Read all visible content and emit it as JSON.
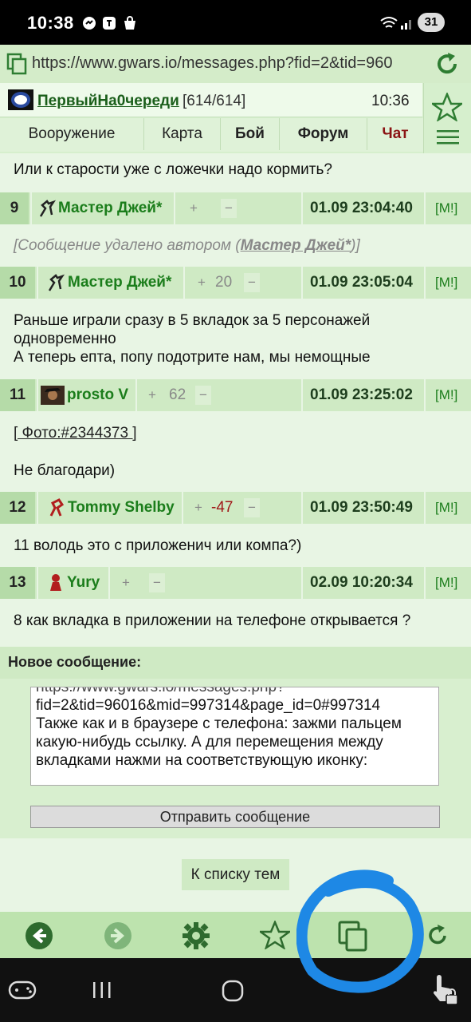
{
  "status": {
    "time": "10:38",
    "battery": "31",
    "signal_label": "5"
  },
  "browser": {
    "url": "https://www.gwars.io/messages.php?fid=2&tid=960"
  },
  "header": {
    "username": "ПервыйНа0череди",
    "hp": "[614/614]",
    "time": "10:36"
  },
  "nav": [
    "Вооружение",
    "Карта",
    "Бой",
    "Форум",
    "Чат"
  ],
  "top_text": "Или к старости уже с ложечки надо кормить?",
  "posts": [
    {
      "num": "9",
      "author": "Мастер Джей*",
      "plus": "+",
      "score": "",
      "minus": "−",
      "date": "01.09 23:04:40",
      "mlink": "[M!]",
      "deleted_prefix": "[Сообщение удалено автором (",
      "deleted_author": "Мастер Джей*",
      "deleted_suffix": ")]"
    },
    {
      "num": "10",
      "author": "Мастер Джей*",
      "plus": "+",
      "score": "20",
      "minus": "−",
      "date": "01.09 23:05:04",
      "mlink": "[M!]",
      "lines": [
        "Раньше играли сразу в 5 вкладок за 5 персонажей",
        "одновременно",
        "А теперь епта, попу подотрите нам, мы немощные"
      ]
    },
    {
      "num": "11",
      "author": "prosto V",
      "plus": "+",
      "score": "62",
      "minus": "−",
      "date": "01.09 23:25:02",
      "mlink": "[M!]",
      "photo": "[ Фото:#2344373 ]",
      "lines": [
        "Не благодари)"
      ]
    },
    {
      "num": "12",
      "author": "Tommy Shelby",
      "plus": "+",
      "score": "-47",
      "minus": "−",
      "date": "01.09 23:50:49",
      "mlink": "[M!]",
      "lines": [
        "11 володь это с приложенич или компа?)"
      ]
    },
    {
      "num": "13",
      "author": "Yury",
      "plus": "+",
      "score": "",
      "minus": "−",
      "date": "02.09 10:20:34",
      "mlink": "[M!]",
      "lines": [
        "8 как вкладка в приложении на телефоне открывается ?"
      ]
    }
  ],
  "compose": {
    "title": "Новое сообщение:",
    "text_lines": [
      "https://www.gwars.io/messages.php?",
      "fid=2&tid=96016&mid=997314&page_id=0#997314",
      "Также как и в браузере с телефона: зажми пальцем",
      "какую-нибудь ссылку. А для перемещения между",
      "вкладками нажми на соответствующую иконку:"
    ],
    "send_label": "Отправить сообщение"
  },
  "back_to_list": "К списку тем",
  "colors": {
    "accent_green": "#1b7d1b",
    "header_bg": "#d6efcd",
    "toolbar_bg": "#bde3ae",
    "negative": "#a01818",
    "chat": "#8b1414",
    "annotation": "#1e88e5"
  }
}
